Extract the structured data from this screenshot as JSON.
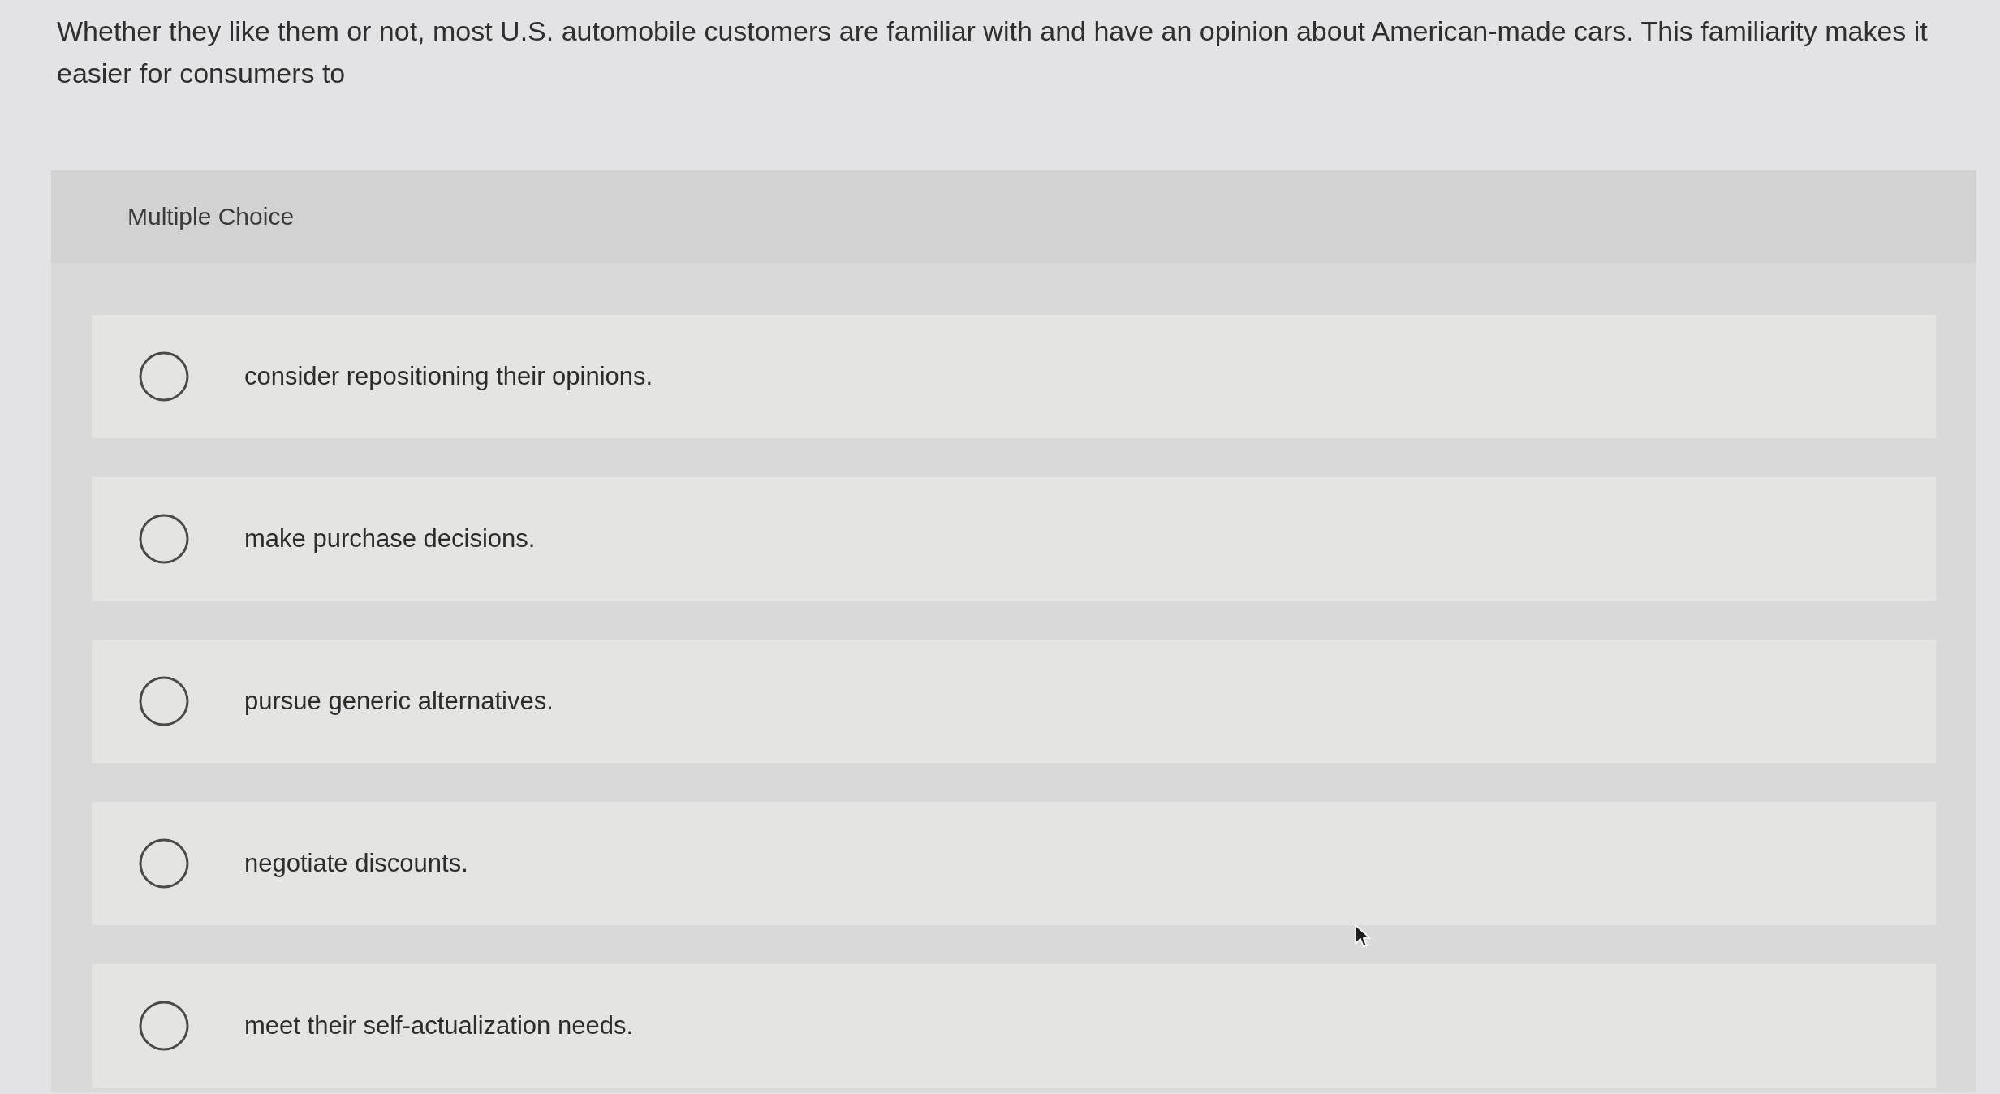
{
  "question": {
    "text": "Whether they like them or not, most U.S. automobile customers are familiar with and have an opinion about American-made cars. This familiarity makes it easier for consumers to"
  },
  "answer_panel": {
    "heading": "Multiple Choice",
    "options": [
      {
        "label": "consider repositioning their opinions.",
        "selected": false
      },
      {
        "label": "make purchase decisions.",
        "selected": false
      },
      {
        "label": "pursue generic alternatives.",
        "selected": false
      },
      {
        "label": "negotiate discounts.",
        "selected": false
      },
      {
        "label": "meet their self-actualization needs.",
        "selected": false
      }
    ]
  }
}
